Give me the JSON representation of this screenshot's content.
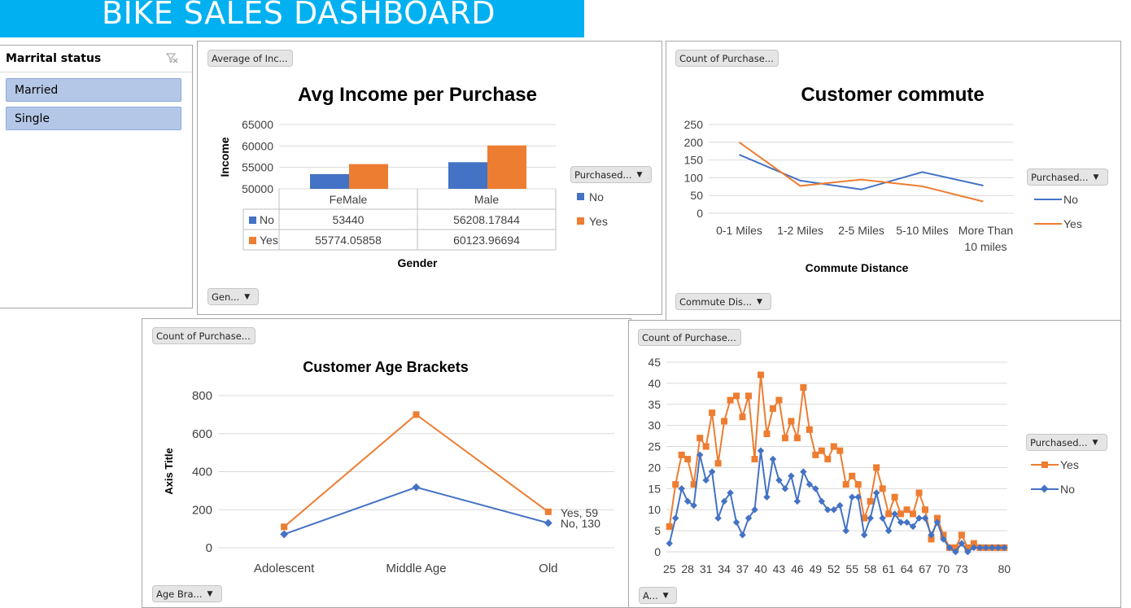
{
  "banner": {
    "title": "BIKE SALES DASHBOARD"
  },
  "slicer": {
    "title": "Marrital status",
    "clear_icon": "clear-filter-icon",
    "items": [
      {
        "label": "Married"
      },
      {
        "label": "Single"
      }
    ]
  },
  "colors": {
    "no": "#4472c4",
    "yes": "#ed7d31",
    "banner": "#00b0f0"
  },
  "income_panel": {
    "value_button": "Average of Inc...",
    "legend_button": "Purchased...",
    "axis_button": "Gen..."
  },
  "commute_panel": {
    "value_button": "Count of Purchase...",
    "legend_button": "Purchased...",
    "axis_button": "Commute Dis..."
  },
  "age_panel": {
    "value_button": "Count of Purchase...",
    "axis_button": "Age Bra..."
  },
  "ages_panel": {
    "value_button": "Count of Purchase...",
    "legend_button": "Purchased...",
    "axis_button": "A..."
  },
  "chart_data": [
    {
      "type": "bar",
      "title": "Avg Income per Purchase",
      "xlabel": "Gender",
      "ylabel": "Income",
      "categories": [
        "FeMale",
        "Male"
      ],
      "ylim": [
        50000,
        65000
      ],
      "yticks": [
        50000,
        55000,
        60000,
        65000
      ],
      "series": [
        {
          "name": "No",
          "values": [
            53440,
            56208.17844
          ],
          "labels": [
            "53440",
            "56208.17844"
          ]
        },
        {
          "name": "Yes",
          "values": [
            55774.05858,
            60123.96694
          ],
          "labels": [
            "55774.05858",
            "60123.96694"
          ]
        }
      ],
      "legend": "right",
      "data_table": true,
      "grid": true
    },
    {
      "type": "line",
      "title": "Customer commute",
      "xlabel": "Commute Distance",
      "ylabel": "",
      "categories": [
        "0-1 Miles",
        "1-2 Miles",
        "2-5 Miles",
        "5-10 Miles",
        "More Than 10 miles"
      ],
      "ylim": [
        0,
        250
      ],
      "yticks": [
        0,
        50,
        100,
        150,
        200,
        250
      ],
      "series": [
        {
          "name": "No",
          "values": [
            165,
            92,
            67,
            116,
            78
          ]
        },
        {
          "name": "Yes",
          "values": [
            200,
            77,
            95,
            76,
            33
          ]
        }
      ],
      "legend": "right",
      "grid": true
    },
    {
      "type": "line",
      "title": "Customer Age Brackets",
      "xlabel": "",
      "ylabel": "Axis Title",
      "categories": [
        "Adolescent",
        "Middle Age",
        "Old"
      ],
      "ylim": [
        0,
        800
      ],
      "yticks": [
        0,
        200,
        400,
        600,
        800
      ],
      "series": [
        {
          "name": "No",
          "values": [
            71,
            318,
            130
          ]
        },
        {
          "name": "Yes",
          "values": [
            110,
            700,
            189
          ]
        }
      ],
      "point_labels": [
        {
          "text": "Yes, 59"
        },
        {
          "text": "No, 130"
        }
      ],
      "grid": true
    },
    {
      "type": "line",
      "title": "",
      "xlabel": "",
      "ylabel": "",
      "x": [
        25,
        26,
        27,
        28,
        29,
        30,
        31,
        32,
        33,
        34,
        35,
        36,
        37,
        38,
        39,
        40,
        41,
        42,
        43,
        44,
        45,
        46,
        47,
        48,
        49,
        50,
        51,
        52,
        53,
        54,
        55,
        56,
        57,
        58,
        59,
        60,
        61,
        62,
        63,
        64,
        65,
        66,
        67,
        68,
        69,
        70,
        71,
        72,
        73,
        74,
        75,
        76,
        77,
        78,
        79,
        80
      ],
      "xticks": [
        25,
        28,
        31,
        34,
        37,
        40,
        43,
        46,
        49,
        52,
        55,
        58,
        61,
        64,
        67,
        70,
        73,
        80
      ],
      "ylim": [
        0,
        45
      ],
      "yticks": [
        0,
        5,
        10,
        15,
        20,
        25,
        30,
        35,
        40,
        45
      ],
      "series": [
        {
          "name": "Yes",
          "values": [
            6,
            16,
            23,
            22,
            16,
            27,
            25,
            33,
            21,
            31,
            36,
            37,
            32,
            37,
            22,
            42,
            28,
            34,
            36,
            27,
            31,
            27,
            39,
            29,
            23,
            24,
            22,
            25,
            24,
            16,
            18,
            16,
            8,
            12,
            20,
            15,
            9,
            13,
            9,
            10,
            9,
            14,
            10,
            3,
            8,
            4,
            1,
            1,
            4,
            1,
            2,
            1,
            1,
            1,
            1,
            1
          ]
        },
        {
          "name": "No",
          "values": [
            2,
            8,
            15,
            12,
            11,
            23,
            17,
            19,
            8,
            12,
            14,
            7,
            4,
            8,
            10,
            24,
            13,
            22,
            17,
            15,
            18,
            12,
            19,
            16,
            15,
            12,
            10,
            10,
            11,
            5,
            13,
            13,
            4,
            8,
            14,
            8,
            5,
            9,
            7,
            7,
            6,
            8,
            8,
            4,
            7,
            3,
            1,
            0,
            2,
            0,
            1,
            1,
            1,
            1,
            1,
            1
          ]
        }
      ],
      "legend": "right",
      "grid": true
    }
  ]
}
